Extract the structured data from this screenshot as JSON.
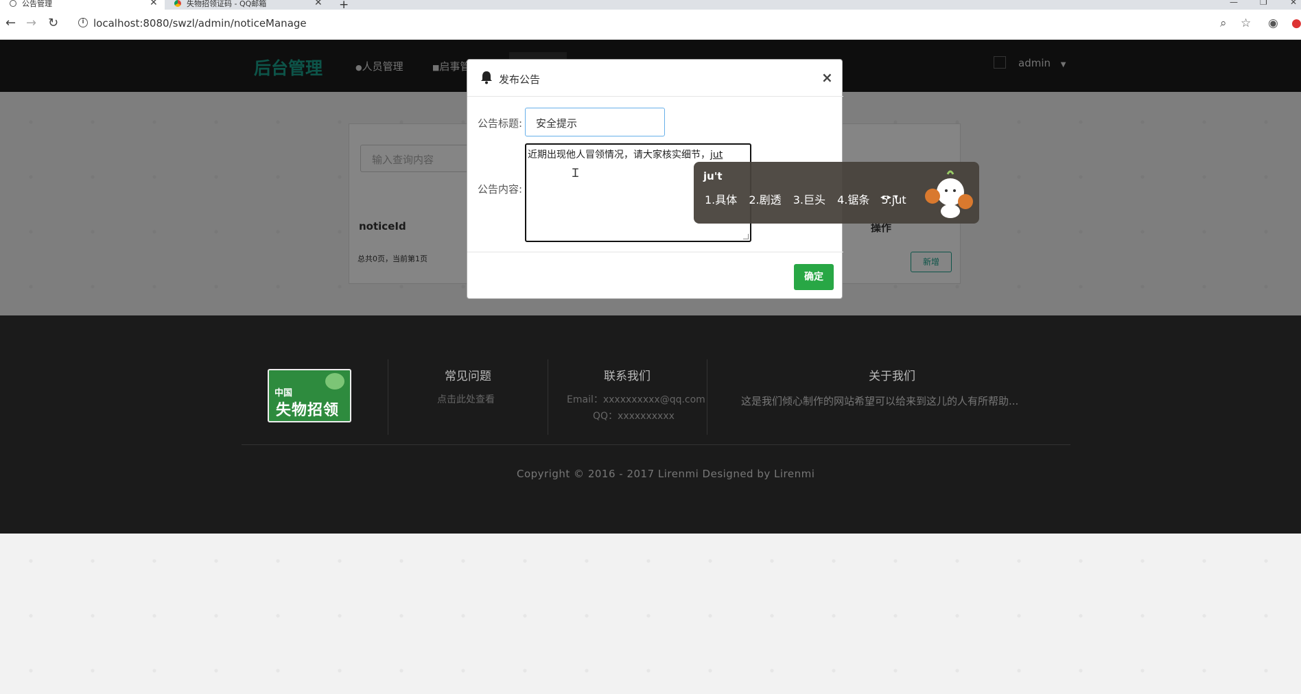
{
  "browser": {
    "tabs": [
      {
        "label": "公告管理",
        "active": true
      },
      {
        "label": "失物招领证码 - QQ邮箱",
        "active": false
      }
    ],
    "url": "localhost:8080/swzl/admin/noticeManage"
  },
  "navbar": {
    "brand": "后台管理",
    "items": [
      "人员管理",
      "启事管"
    ],
    "user": "admin"
  },
  "panel": {
    "search_placeholder": "输入查询内容",
    "col_notice_id": "noticeId",
    "col_actions": "操作",
    "pager": "总共0页，当前第1页",
    "new_button": "新增"
  },
  "modal": {
    "title": "发布公告",
    "close": "×",
    "title_label": "公告标题:",
    "title_value": "安全提示",
    "content_label": "公告内容:",
    "content_value": "近期出现他人冒领情况，请大家核实细节，",
    "content_composing": "jut",
    "confirm": "确定"
  },
  "ime": {
    "input": "ju't",
    "candidates": [
      "1.具体",
      "2.剧透",
      "3.巨头",
      "4.锯条",
      "5.jut"
    ]
  },
  "footer": {
    "faq_title": "常见问题",
    "faq_link": "点击此处查看",
    "contact_title": "联系我们",
    "contact_email": "Email：xxxxxxxxxx@qq.com",
    "contact_qq": "QQ：xxxxxxxxxx",
    "about_title": "关于我们",
    "about_text": "这是我们倾心制作的网站希望可以给来到这儿的人有所帮助...",
    "logo_line1": "中国",
    "logo_line2": "失物招领",
    "copyright": "Copyright © 2016 - 2017 Lirenmi Designed by Lirenmi"
  },
  "colors": {
    "brand": "#1aa28c",
    "confirm_button": "#28a745",
    "navbar_bg": "#1b1b1b"
  }
}
